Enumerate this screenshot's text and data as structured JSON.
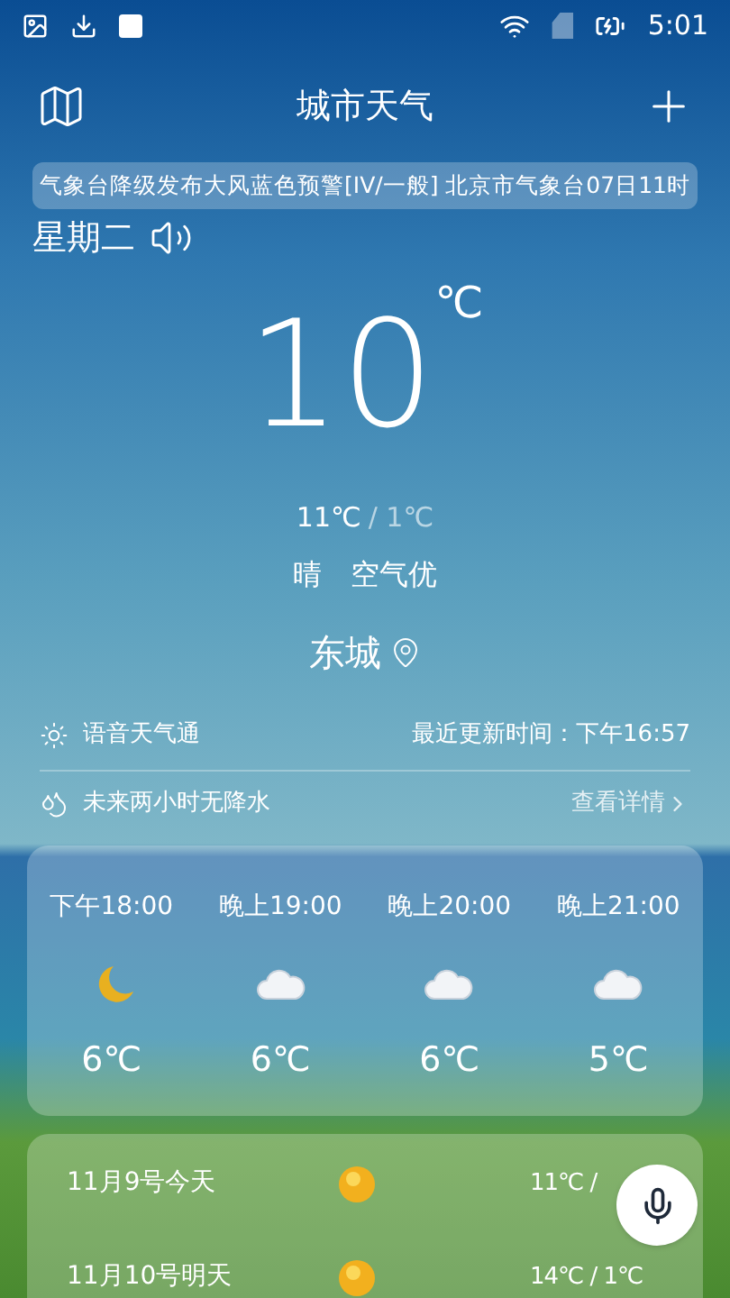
{
  "status_bar": {
    "time": "5:01"
  },
  "header": {
    "title": "城市天气"
  },
  "ticker": {
    "text": "气象台降级发布大风蓝色预警[IV/一般]  北京市气象台07日11时"
  },
  "weekday": "星期二",
  "current": {
    "temp": "10",
    "unit": "℃",
    "high": "11℃",
    "low": "/ 1℃",
    "condition": "晴",
    "air": "空气优",
    "city": "东城"
  },
  "info_rows": [
    {
      "kind": "voice",
      "text": "语音天气通",
      "detail": "最近更新时间：下午16:57"
    },
    {
      "kind": "rain",
      "text": "未来两小时无降水",
      "detail": "查看详情"
    }
  ],
  "hourly": [
    {
      "time": "下午18:00",
      "kind": "moon",
      "temp": "6℃"
    },
    {
      "time": "晚上19:00",
      "kind": "cloud",
      "temp": "6℃"
    },
    {
      "time": "晚上20:00",
      "kind": "cloud",
      "temp": "6℃"
    },
    {
      "time": "晚上21:00",
      "kind": "cloud",
      "temp": "5℃"
    }
  ],
  "daily": [
    {
      "day": "11月9号今天",
      "kind": "sun",
      "temps": "11℃ /"
    },
    {
      "day": "11月10号明天",
      "kind": "sun",
      "temps": "14℃ / 1℃"
    }
  ]
}
